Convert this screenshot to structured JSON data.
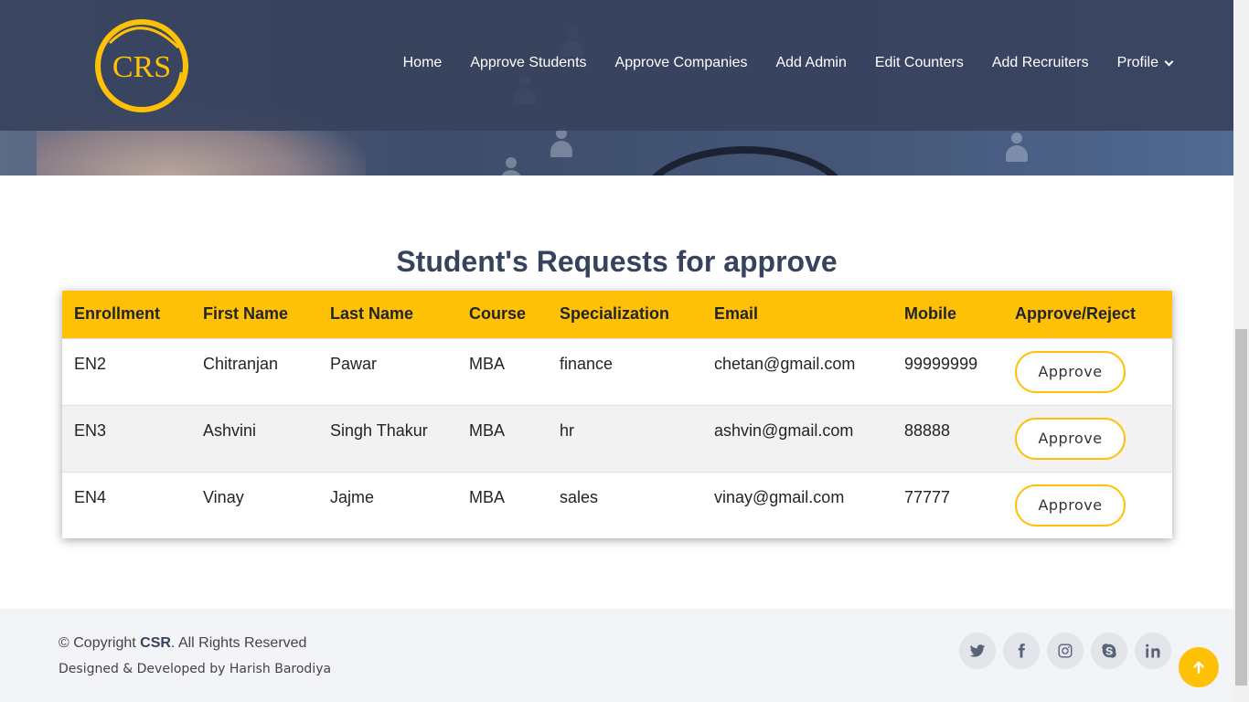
{
  "brand": {
    "logo_text": "CRS",
    "accent": "#ffc107",
    "nav_bg": "#37425d"
  },
  "nav": {
    "items": [
      {
        "label": "Home"
      },
      {
        "label": "Approve Students"
      },
      {
        "label": "Approve Companies"
      },
      {
        "label": "Add Admin"
      },
      {
        "label": "Edit Counters"
      },
      {
        "label": "Add Recruiters"
      },
      {
        "label": "Profile",
        "icon": "chevron-down-icon"
      }
    ]
  },
  "main": {
    "title": "Student's Requests for approve",
    "columns": [
      "Enrollment",
      "First Name",
      "Last Name",
      "Course",
      "Specialization",
      "Email",
      "Mobile",
      "Approve/Reject"
    ],
    "rows": [
      {
        "enrollment": "EN2",
        "first_name": "Chitranjan",
        "last_name": "Pawar",
        "course": "MBA",
        "specialization": "finance",
        "email": "chetan@gmail.com",
        "mobile": "99999999",
        "action": "Approve"
      },
      {
        "enrollment": "EN3",
        "first_name": "Ashvini",
        "last_name": "Singh Thakur",
        "course": "MBA",
        "specialization": "hr",
        "email": "ashvin@gmail.com",
        "mobile": "88888",
        "action": "Approve"
      },
      {
        "enrollment": "EN4",
        "first_name": "Vinay",
        "last_name": "Jajme",
        "course": "MBA",
        "specialization": "sales",
        "email": "vinay@gmail.com",
        "mobile": "77777",
        "action": "Approve"
      }
    ]
  },
  "footer": {
    "copyright_prefix": "© Copyright ",
    "copyright_brand": "CSR",
    "copyright_suffix": ". All Rights Reserved",
    "credits": "Designed & Developed by Harish Barodiya",
    "social": [
      "twitter-icon",
      "facebook-icon",
      "instagram-icon",
      "skype-icon",
      "linkedin-icon"
    ]
  }
}
